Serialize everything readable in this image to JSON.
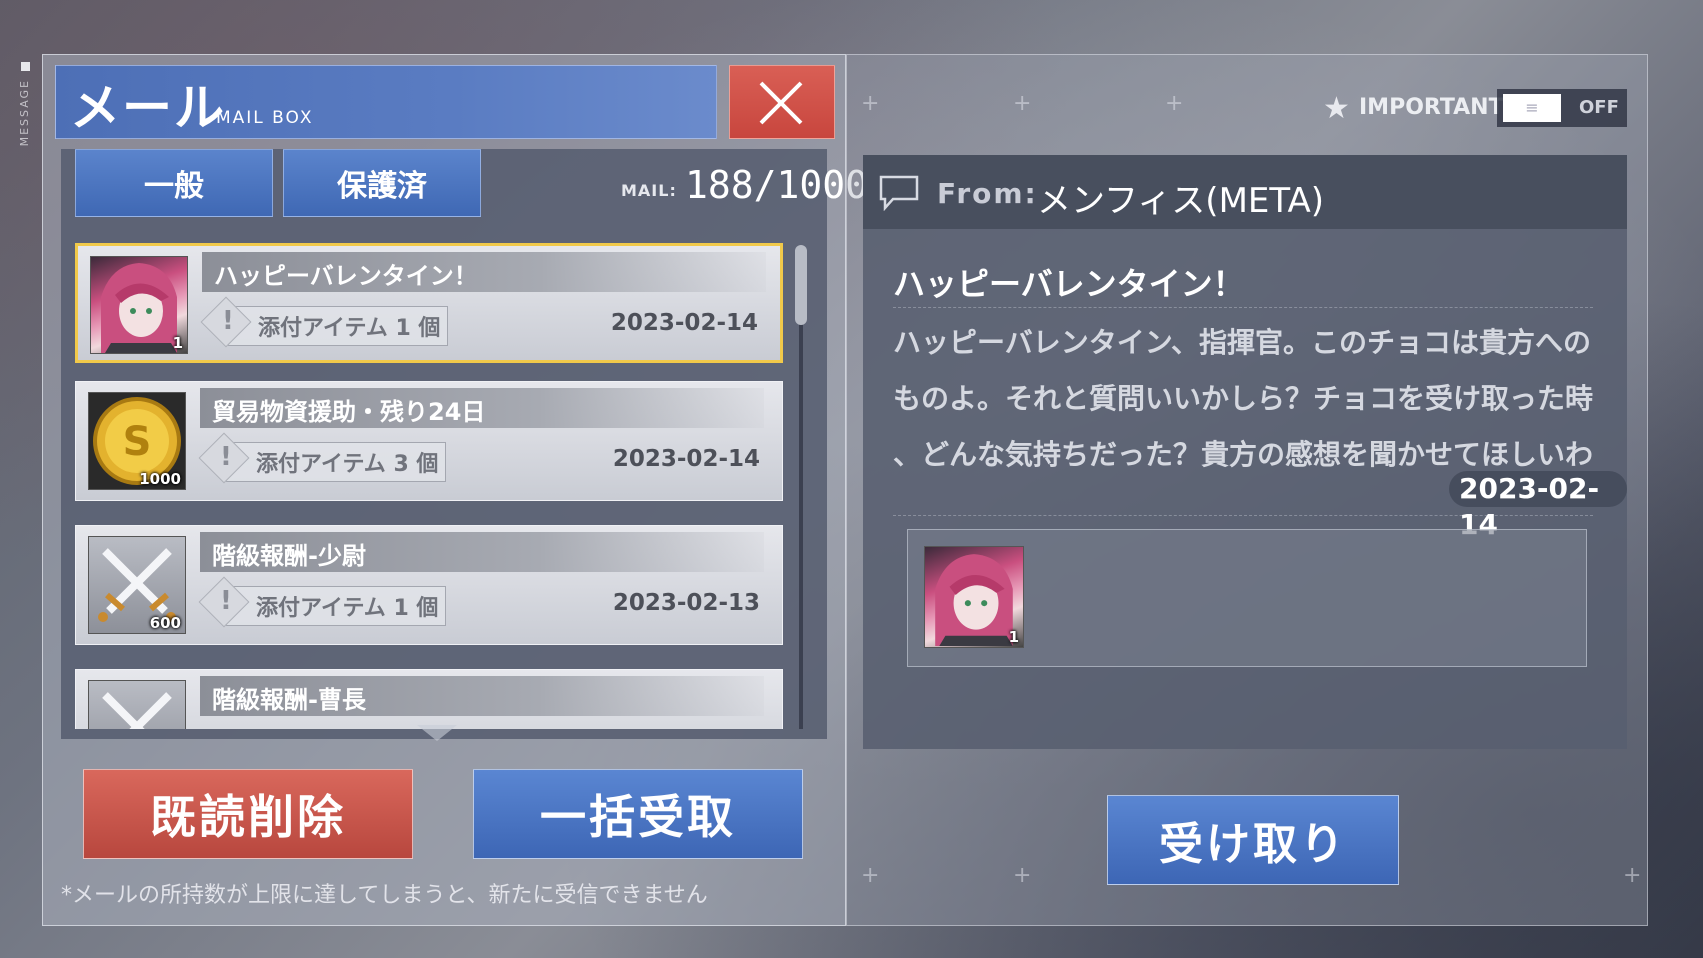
{
  "side_tag": "MESSAGE",
  "header": {
    "title": "メール",
    "subtitle": "MAIL BOX"
  },
  "tabs": [
    {
      "label": "一般"
    },
    {
      "label": "保護済"
    }
  ],
  "mail_counter": {
    "label": "MAIL:",
    "value": "188/1000"
  },
  "mails": [
    {
      "subject": "ハッピーバレンタイン！",
      "attachment": "添付アイテム 1 個",
      "date": "2023-02-14",
      "thumb_qty": "1",
      "icon": "character-portrait-icon"
    },
    {
      "subject": "貿易物資援助・残り24日",
      "attachment": "添付アイテム 3 個",
      "date": "2023-02-14",
      "thumb_qty": "1000",
      "icon": "gold-coin-icon"
    },
    {
      "subject": "階級報酬-少尉",
      "attachment": "添付アイテム 1 個",
      "date": "2023-02-13",
      "thumb_qty": "600",
      "icon": "crossed-swords-icon"
    },
    {
      "subject": "階級報酬-曹長",
      "icon": "crossed-swords-icon"
    }
  ],
  "buttons": {
    "delete_read": "既読削除",
    "receive_all": "一括受取",
    "receive": "受け取り"
  },
  "footnote": "*メールの所持数が上限に達してしまうと、新たに受信できません",
  "important": {
    "label": "IMPORTANT",
    "toggle_state": "OFF",
    "toggle_knob": "≡"
  },
  "detail": {
    "from_label": "From:",
    "from_name": "メンフィス(META)",
    "subject": "ハッピーバレンタイン！",
    "body_lines": [
      "ハッピーバレンタイン、指揮官。このチョコは貴方への",
      "ものよ。それと質問いいかしら？チョコを受け取った時",
      "、どんな気持ちだった？貴方の感想を聞かせてほしいわ"
    ],
    "date": "2023-02-14",
    "attachment_qty": "1"
  },
  "colors": {
    "accent_blue": "#4d6fb6",
    "danger_red": "#c8463e",
    "selected_border": "#f1c94a"
  }
}
